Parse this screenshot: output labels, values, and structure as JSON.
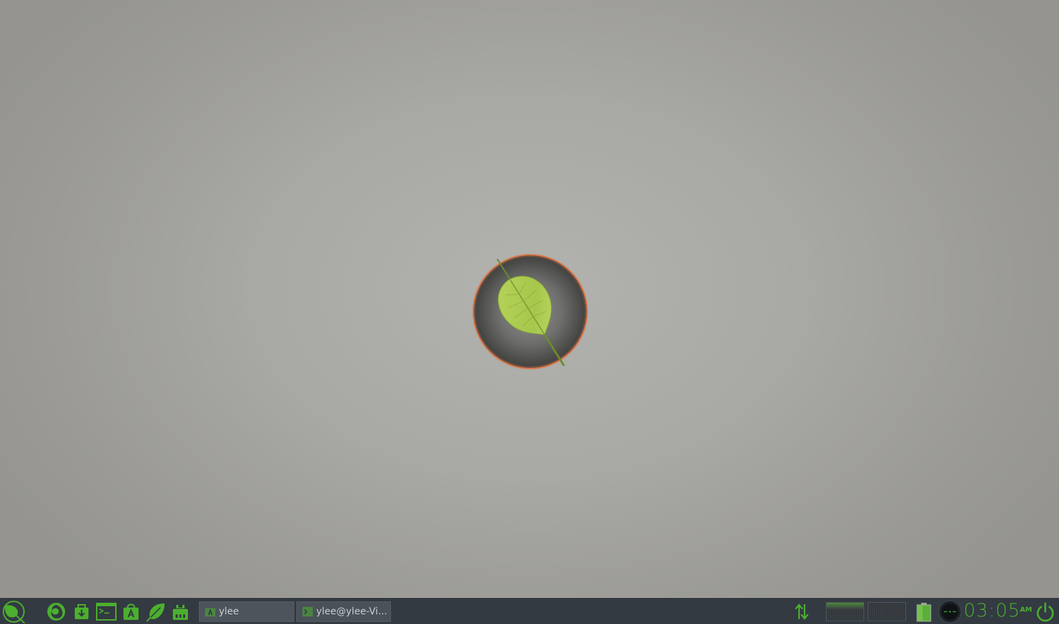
{
  "desktop": {
    "wallpaper_icon": "peppermint-leaf-logo"
  },
  "taskbar": {
    "menu_icon": "leaf-menu-icon",
    "launchers": [
      {
        "name": "firefox",
        "icon": "firefox-icon"
      },
      {
        "name": "software-installer",
        "icon": "package-download-icon"
      },
      {
        "name": "terminal",
        "icon": "terminal-icon"
      },
      {
        "name": "app-store",
        "icon": "app-store-icon"
      },
      {
        "name": "ice",
        "icon": "leaf-icon"
      },
      {
        "name": "drive",
        "icon": "drive-icon"
      }
    ],
    "tasks": [
      {
        "label": "ylee"
      },
      {
        "label": "ylee@ylee-Vi..."
      }
    ],
    "clock": {
      "time": "03:05",
      "ampm": "AM"
    }
  },
  "colors": {
    "accent": "#4caf2f",
    "taskbar_bg": "#333a42",
    "desktop_bg": "#a8a8a4"
  }
}
